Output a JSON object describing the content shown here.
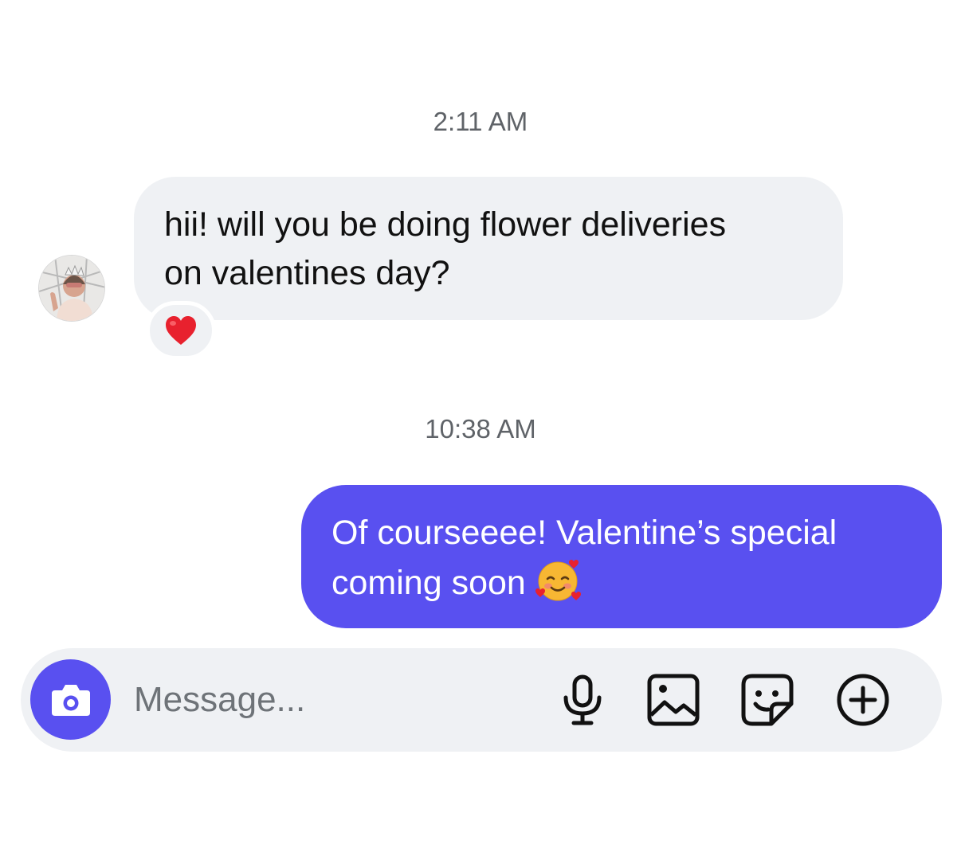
{
  "thread": {
    "timestamp_1": "2:11 AM",
    "incoming_message": {
      "line_1": "hii! will you be doing flower deliveries",
      "line_2": "on valentines day?",
      "reaction": "red-heart"
    },
    "timestamp_2": "10:38 AM",
    "outgoing_message": {
      "line_1": "Of courseeee! Valentine’s special",
      "line_2": "coming soon",
      "emoji": "smiling-face-with-hearts"
    }
  },
  "composer": {
    "placeholder": "Message...",
    "icons": [
      "camera-icon",
      "microphone-icon",
      "gallery-icon",
      "sticker-icon",
      "plus-icon"
    ]
  },
  "colors": {
    "accent": "#5950f0",
    "incoming_bubble": "#eff1f4",
    "timestamp_text": "#5f6368"
  }
}
